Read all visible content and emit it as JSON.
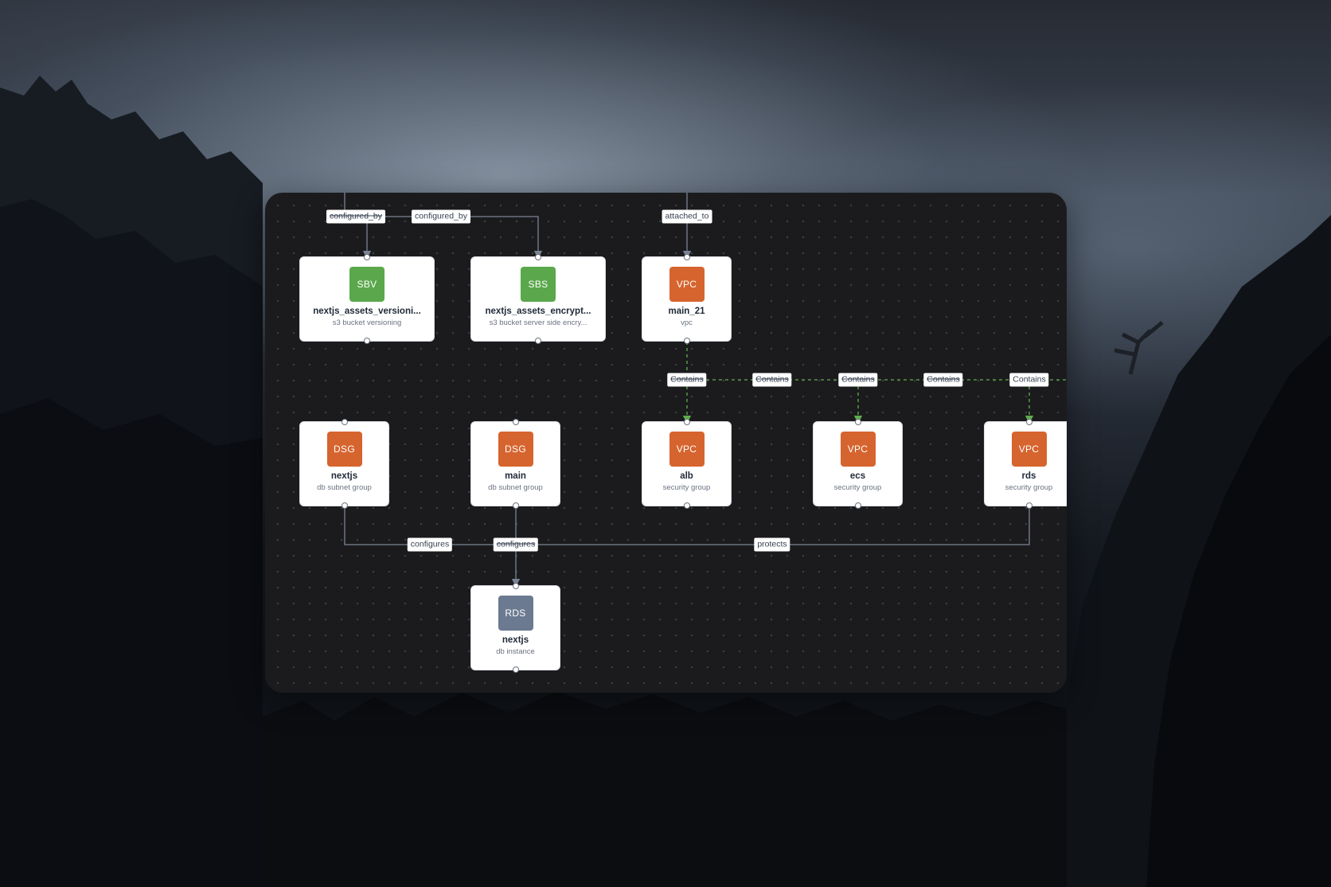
{
  "colors": {
    "panel_bg": "#1b1b1d",
    "edge_solid": "#7b8494",
    "edge_dashed": "#5fae4e",
    "badge_green": "#5aa84b",
    "badge_orange": "#d6642e",
    "badge_slate": "#6b7a90"
  },
  "nodes": [
    {
      "id": "sbv",
      "badge": "SBV",
      "title": "nextjs_assets_versioni...",
      "subtitle": "s3 bucket versioning",
      "badge_color": "#5aa84b"
    },
    {
      "id": "sbs",
      "badge": "SBS",
      "title": "nextjs_assets_encrypt...",
      "subtitle": "s3 bucket server side encry...",
      "badge_color": "#5aa84b"
    },
    {
      "id": "vpc_main",
      "badge": "VPC",
      "title": "main_21",
      "subtitle": "vpc",
      "badge_color": "#d6642e"
    },
    {
      "id": "dsg_nextjs",
      "badge": "DSG",
      "title": "nextjs",
      "subtitle": "db subnet group",
      "badge_color": "#d6642e"
    },
    {
      "id": "dsg_main",
      "badge": "DSG",
      "title": "main",
      "subtitle": "db subnet group",
      "badge_color": "#d6642e"
    },
    {
      "id": "sg_alb",
      "badge": "VPC",
      "title": "alb",
      "subtitle": "security group",
      "badge_color": "#d6642e"
    },
    {
      "id": "sg_ecs",
      "badge": "VPC",
      "title": "ecs",
      "subtitle": "security group",
      "badge_color": "#d6642e"
    },
    {
      "id": "sg_rds",
      "badge": "VPC",
      "title": "rds",
      "subtitle": "security group",
      "badge_color": "#d6642e"
    },
    {
      "id": "rds_nextjs",
      "badge": "RDS",
      "title": "nextjs",
      "subtitle": "db instance",
      "badge_color": "#6b7a90"
    }
  ],
  "edge_labels": [
    {
      "id": "e1",
      "text": "configured_by",
      "strike": true
    },
    {
      "id": "e2",
      "text": "configured_by",
      "strike": false
    },
    {
      "id": "e3",
      "text": "attached_to",
      "strike": false
    },
    {
      "id": "e4",
      "text": "Contains",
      "strike": true
    },
    {
      "id": "e5",
      "text": "Contains",
      "strike": true
    },
    {
      "id": "e6",
      "text": "Contains",
      "strike": true
    },
    {
      "id": "e7",
      "text": "Contains",
      "strike": true
    },
    {
      "id": "e8",
      "text": "Contains",
      "strike": false
    },
    {
      "id": "e9",
      "text": "configures",
      "strike": false
    },
    {
      "id": "e10",
      "text": "configures",
      "strike": true
    },
    {
      "id": "e11",
      "text": "protects",
      "strike": false
    }
  ]
}
